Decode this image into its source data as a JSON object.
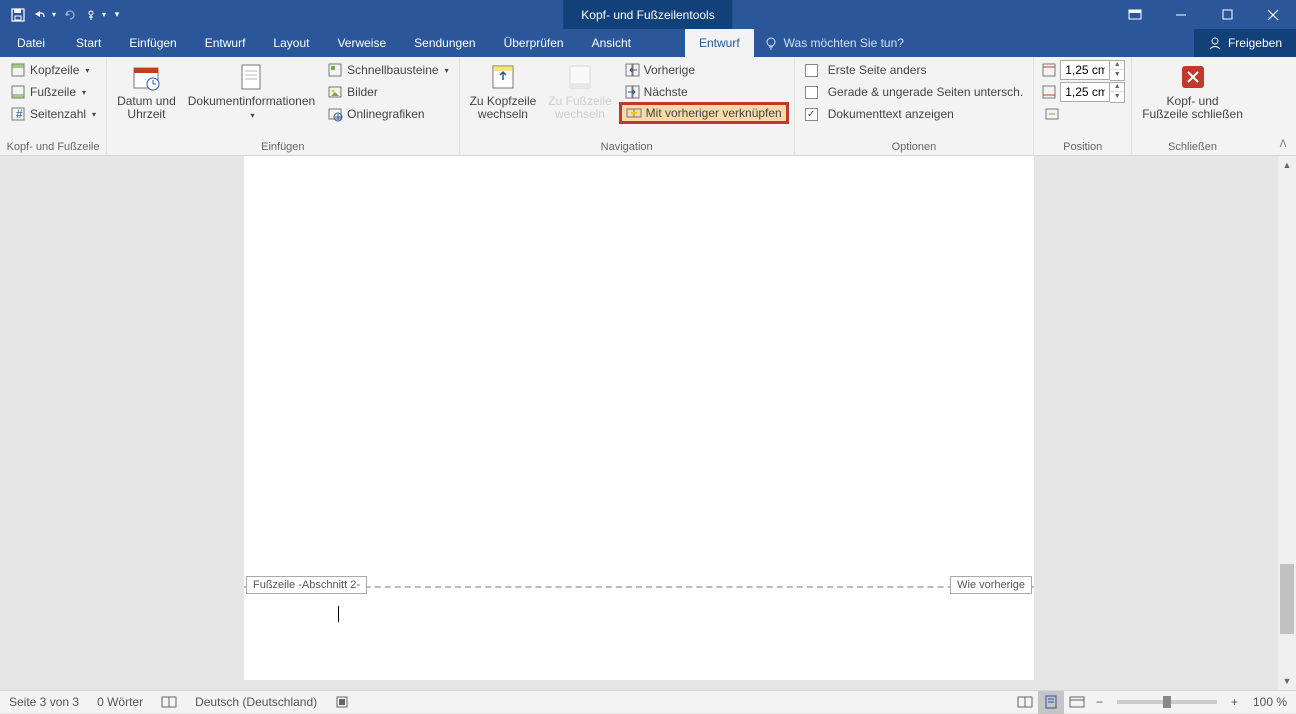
{
  "title_context": "Kopf- und Fußzeilentools",
  "tabs": {
    "datei": "Datei",
    "start": "Start",
    "einfuegen": "Einfügen",
    "entwurf": "Entwurf",
    "layout": "Layout",
    "verweise": "Verweise",
    "sendungen": "Sendungen",
    "ueberpruefen": "Überprüfen",
    "ansicht": "Ansicht",
    "entwurf2": "Entwurf"
  },
  "tellme_placeholder": "Was möchten Sie tun?",
  "share": "Freigeben",
  "groups": {
    "kf": {
      "kopfzeile": "Kopfzeile",
      "fusszeile": "Fußzeile",
      "seitenzahl": "Seitenzahl",
      "label": "Kopf- und Fußzeile"
    },
    "einfuegen": {
      "datum": "Datum und\nUhrzeit",
      "dokinfo": "Dokumentinformationen",
      "schnell": "Schnellbausteine",
      "bilder": "Bilder",
      "online": "Onlinegrafiken",
      "label": "Einfügen"
    },
    "navigation": {
      "zukopf": "Zu Kopfzeile\nwechseln",
      "zufuss": "Zu Fußzeile\nwechseln",
      "vorherige": "Vorherige",
      "naechste": "Nächste",
      "mitvor": "Mit vorheriger verknüpfen",
      "label": "Navigation"
    },
    "optionen": {
      "erste": "Erste Seite anders",
      "gerade": "Gerade & ungerade Seiten untersch.",
      "doktext": "Dokumenttext anzeigen",
      "label": "Optionen"
    },
    "position": {
      "top": "1,25 cm",
      "bottom": "1,25 cm",
      "label": "Position"
    },
    "schliessen": {
      "btn": "Kopf- und\nFußzeile schließen",
      "label": "Schließen"
    }
  },
  "footer": {
    "tag_left": "Fußzeile -Abschnitt 2-",
    "tag_right": "Wie vorherige"
  },
  "statusbar": {
    "page": "Seite 3 von 3",
    "words": "0 Wörter",
    "lang": "Deutsch (Deutschland)",
    "zoom": "100 %"
  }
}
